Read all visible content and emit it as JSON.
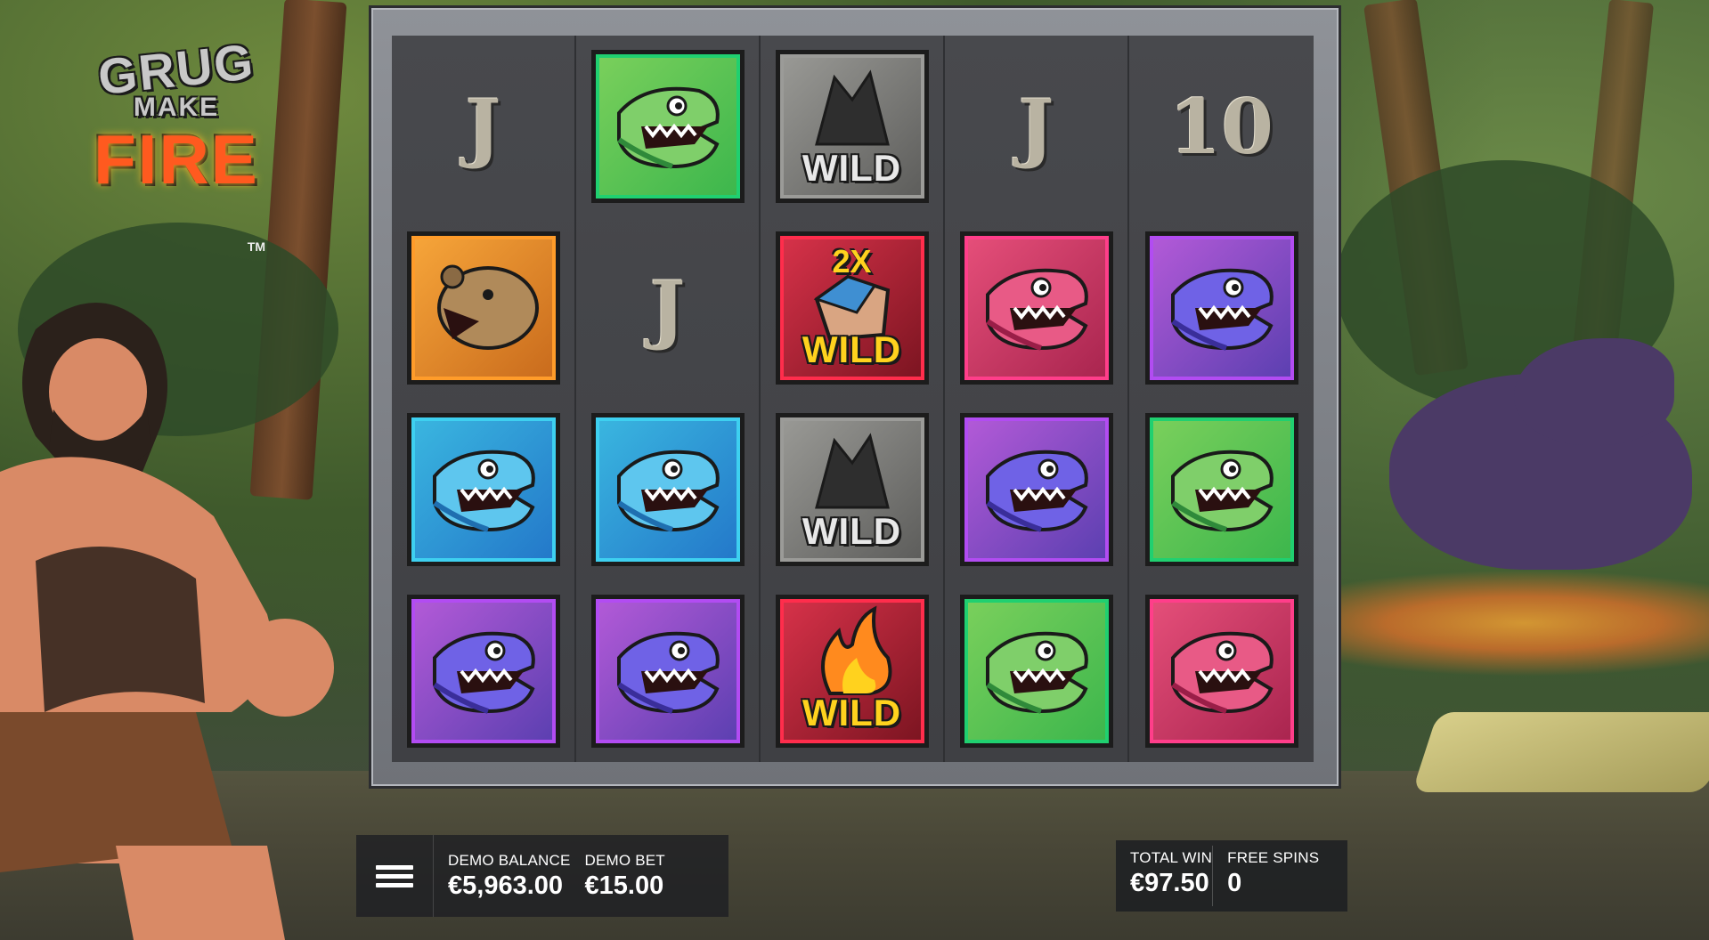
{
  "game": {
    "logo_line1": "GRUG",
    "logo_line2": "MAKE",
    "logo_line3": "FIRE",
    "logo_tm": "TM"
  },
  "reels": [
    [
      {
        "symbol": "card",
        "label": "J"
      },
      {
        "symbol": "bear",
        "label": ""
      },
      {
        "symbol": "blue-shark",
        "label": ""
      },
      {
        "symbol": "purple-dino",
        "label": ""
      }
    ],
    [
      {
        "symbol": "green-dino",
        "label": ""
      },
      {
        "symbol": "card",
        "label": "J"
      },
      {
        "symbol": "blue-shark",
        "label": ""
      },
      {
        "symbol": "purple-dino",
        "label": ""
      }
    ],
    [
      {
        "symbol": "stone-wild",
        "label": "WILD"
      },
      {
        "symbol": "multiplier-wild",
        "label": "WILD",
        "multiplier": "2X"
      },
      {
        "symbol": "stone-wild",
        "label": "WILD"
      },
      {
        "symbol": "fire-wild",
        "label": "WILD"
      }
    ],
    [
      {
        "symbol": "card",
        "label": "J"
      },
      {
        "symbol": "pink-dino",
        "label": ""
      },
      {
        "symbol": "purple-dino",
        "label": ""
      },
      {
        "symbol": "green-dino",
        "label": ""
      }
    ],
    [
      {
        "symbol": "card",
        "label": "10"
      },
      {
        "symbol": "purple-dino",
        "label": ""
      },
      {
        "symbol": "green-dino",
        "label": ""
      },
      {
        "symbol": "pink-dino",
        "label": ""
      }
    ]
  ],
  "hud": {
    "balance_label": "DEMO BALANCE",
    "balance_value": "€5,963.00",
    "bet_label": "DEMO BET",
    "bet_value": "€15.00",
    "total_win_label": "TOTAL WIN",
    "total_win_value": "€97.50",
    "free_spins_label": "FREE SPINS",
    "free_spins_value": "0"
  },
  "icons": {
    "menu": "hamburger-menu-icon"
  },
  "colors": {
    "green_tile": "#3bb64c",
    "blue_tile": "#2377c9",
    "purple_tile": "#5a3fb0",
    "pink_tile": "#a8244e",
    "orange_tile": "#c86a1c",
    "wild_gold": "#ffd21e"
  }
}
